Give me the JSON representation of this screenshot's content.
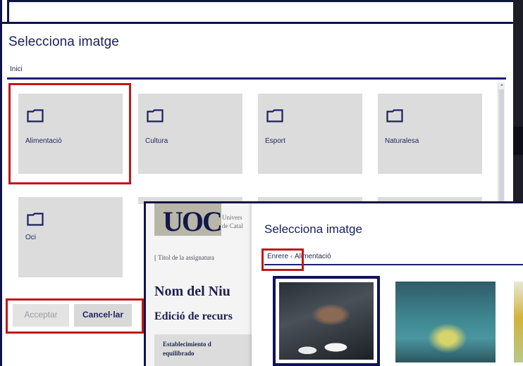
{
  "dialog1": {
    "title": "Selecciona imatge",
    "breadcrumb": "Inici",
    "folders": [
      {
        "label": "Alimentació",
        "icon": "folder-icon"
      },
      {
        "label": "Cultura",
        "icon": "folder-icon"
      },
      {
        "label": "Esport",
        "icon": "folder-icon"
      },
      {
        "label": "Naturalesa",
        "icon": "folder-icon"
      },
      {
        "label": "Oci",
        "icon": "folder-icon"
      }
    ],
    "accept_label": "Acceptar",
    "cancel_label": "Cancel·lar"
  },
  "background_page": {
    "logo": "UOC",
    "university": "Univers\nde Catal",
    "course": "[ Títol de la assignatura",
    "niu_title": "Nom del Niu",
    "edicio": "Edició de recurs",
    "card_text": "Establecimiento d\nequilibrado"
  },
  "dialog2": {
    "title": "Selecciona imatge",
    "back_label": "Enrere",
    "separator": "‹",
    "current_folder": "Alimentació"
  },
  "colors": {
    "highlight": "#c01818",
    "brand_navy": "#1a2060",
    "tile_bg": "#dcdcdc"
  }
}
